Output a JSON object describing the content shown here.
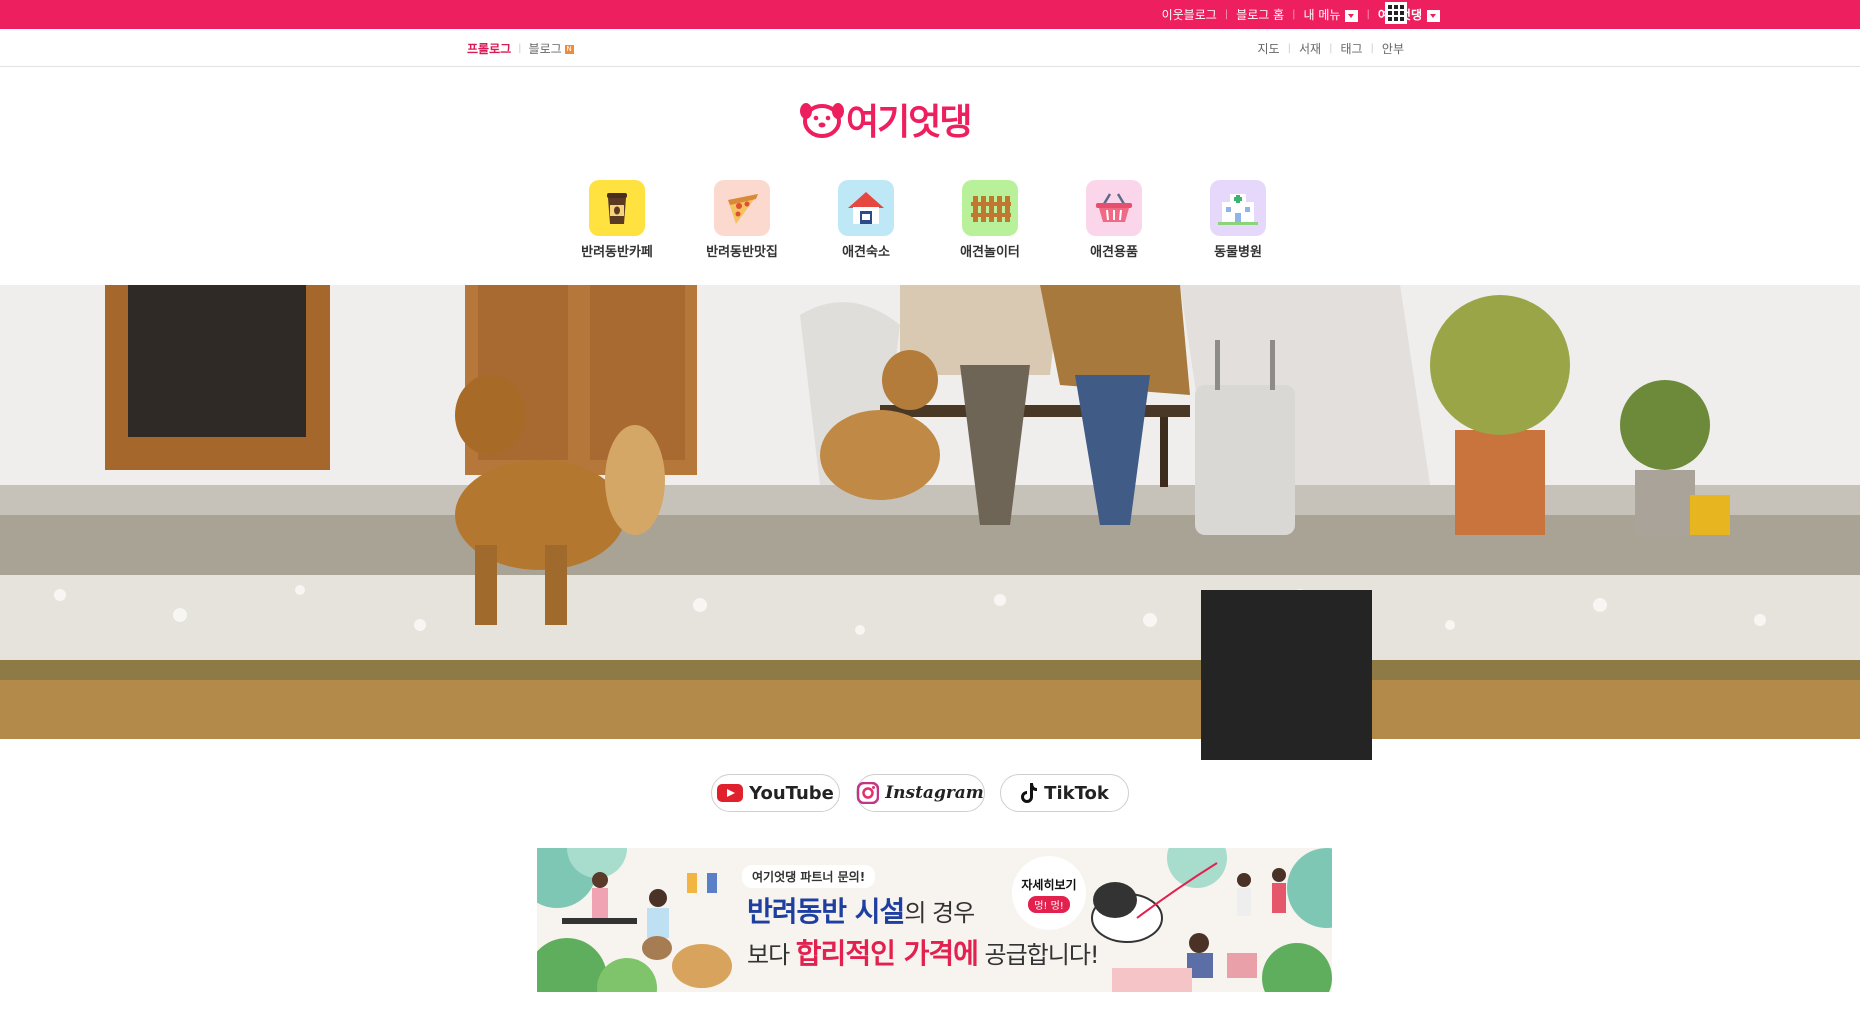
{
  "topbar": {
    "items": [
      "이웃블로그",
      "블로그 홈",
      "내 메뉴",
      "여기엇댕"
    ],
    "bg_color": "#ee1f5e"
  },
  "subnav": {
    "left": [
      "프롤로그",
      "블로그"
    ],
    "new_badge": "N",
    "right": [
      "지도",
      "서재",
      "태그",
      "안부"
    ]
  },
  "logo": {
    "text": "여기엇댕",
    "icon": "puppy-face-icon"
  },
  "categories": [
    {
      "label": "반려동반카페",
      "icon": "coffee-cup-icon"
    },
    {
      "label": "반려동반맛집",
      "icon": "pizza-slice-icon"
    },
    {
      "label": "애견숙소",
      "icon": "house-icon"
    },
    {
      "label": "애견놀이터",
      "icon": "fence-icon"
    },
    {
      "label": "애견용품",
      "icon": "basket-icon"
    },
    {
      "label": "동물병원",
      "icon": "hospital-icon"
    }
  ],
  "socials": [
    {
      "label": "YouTube",
      "icon": "youtube-icon"
    },
    {
      "label": "Instagram",
      "icon": "instagram-icon"
    },
    {
      "label": "TikTok",
      "icon": "tiktok-icon"
    }
  ],
  "banner": {
    "tag": "여기엇댕 파트너 문의!",
    "line1_a": "반려동반 시설",
    "line1_b": "의 경우",
    "line2_a": "보다 ",
    "line2_b": "합리적인 가격에",
    "line2_c": " 공급합니다!",
    "more_title": "자세히보기",
    "more_sub": "멍! 멍!"
  }
}
